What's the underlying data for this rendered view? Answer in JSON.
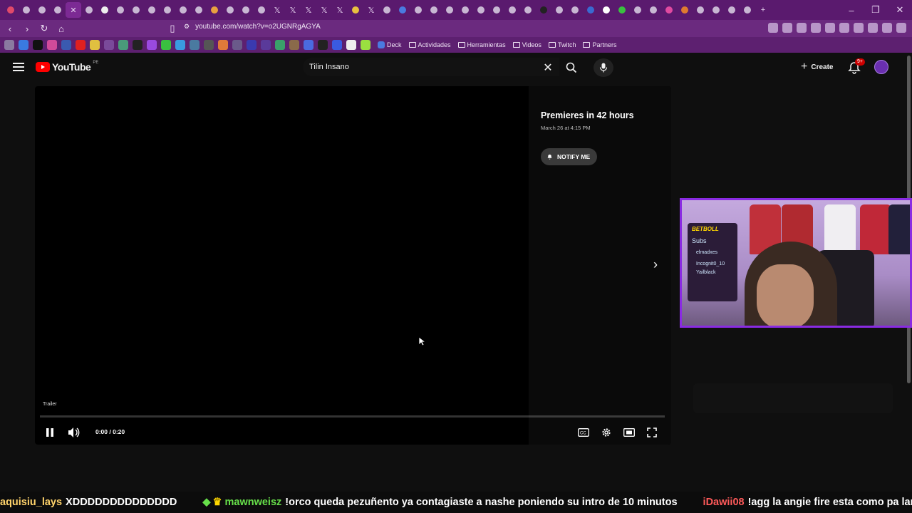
{
  "browser": {
    "url": "youtube.com/watch?v=o2UGNRgAGYA",
    "bookmarks": [
      {
        "label": "Deck"
      },
      {
        "label": "Actividades"
      },
      {
        "label": "Herramientas"
      },
      {
        "label": "Videos"
      },
      {
        "label": "Twitch"
      },
      {
        "label": "Partners"
      }
    ]
  },
  "youtube": {
    "logo_text": "YouTube",
    "country_code": "PE",
    "search_value": "Tilin Insano",
    "create_label": "Create",
    "notification_badge": "9+"
  },
  "player": {
    "premiere_title": "Premieres in 42 hours",
    "premiere_date": "March 26 at 4:15 PM",
    "notify_label": "NOTIFY ME",
    "trailer_label": "Trailer",
    "time": "0:00 / 0:20",
    "progress": 0
  },
  "webcam": {
    "brand": "BETBOLL",
    "lines": [
      "Subs",
      "elmadxes",
      "Incognit0_10",
      "Yailblack"
    ]
  },
  "ticker": [
    {
      "user": "aquisiu_lays",
      "user_color": "#ffd36b",
      "msg": "XDDDDDDDDDDDDDD"
    },
    {
      "user": "mawnweisz",
      "user_color": "#67e04a",
      "msg": "!orco queda pezuñento ya contagiaste a nashe poniendo su intro de 10 minutos"
    },
    {
      "user": "iDawii08",
      "user_color": "#ff5a5a",
      "msg": "!agg la angie fire esta como pa lamin"
    }
  ],
  "colors": {
    "tabstrip": "#5a1a6e",
    "accent": "#8a2be2",
    "yt_red": "#ff0000"
  }
}
